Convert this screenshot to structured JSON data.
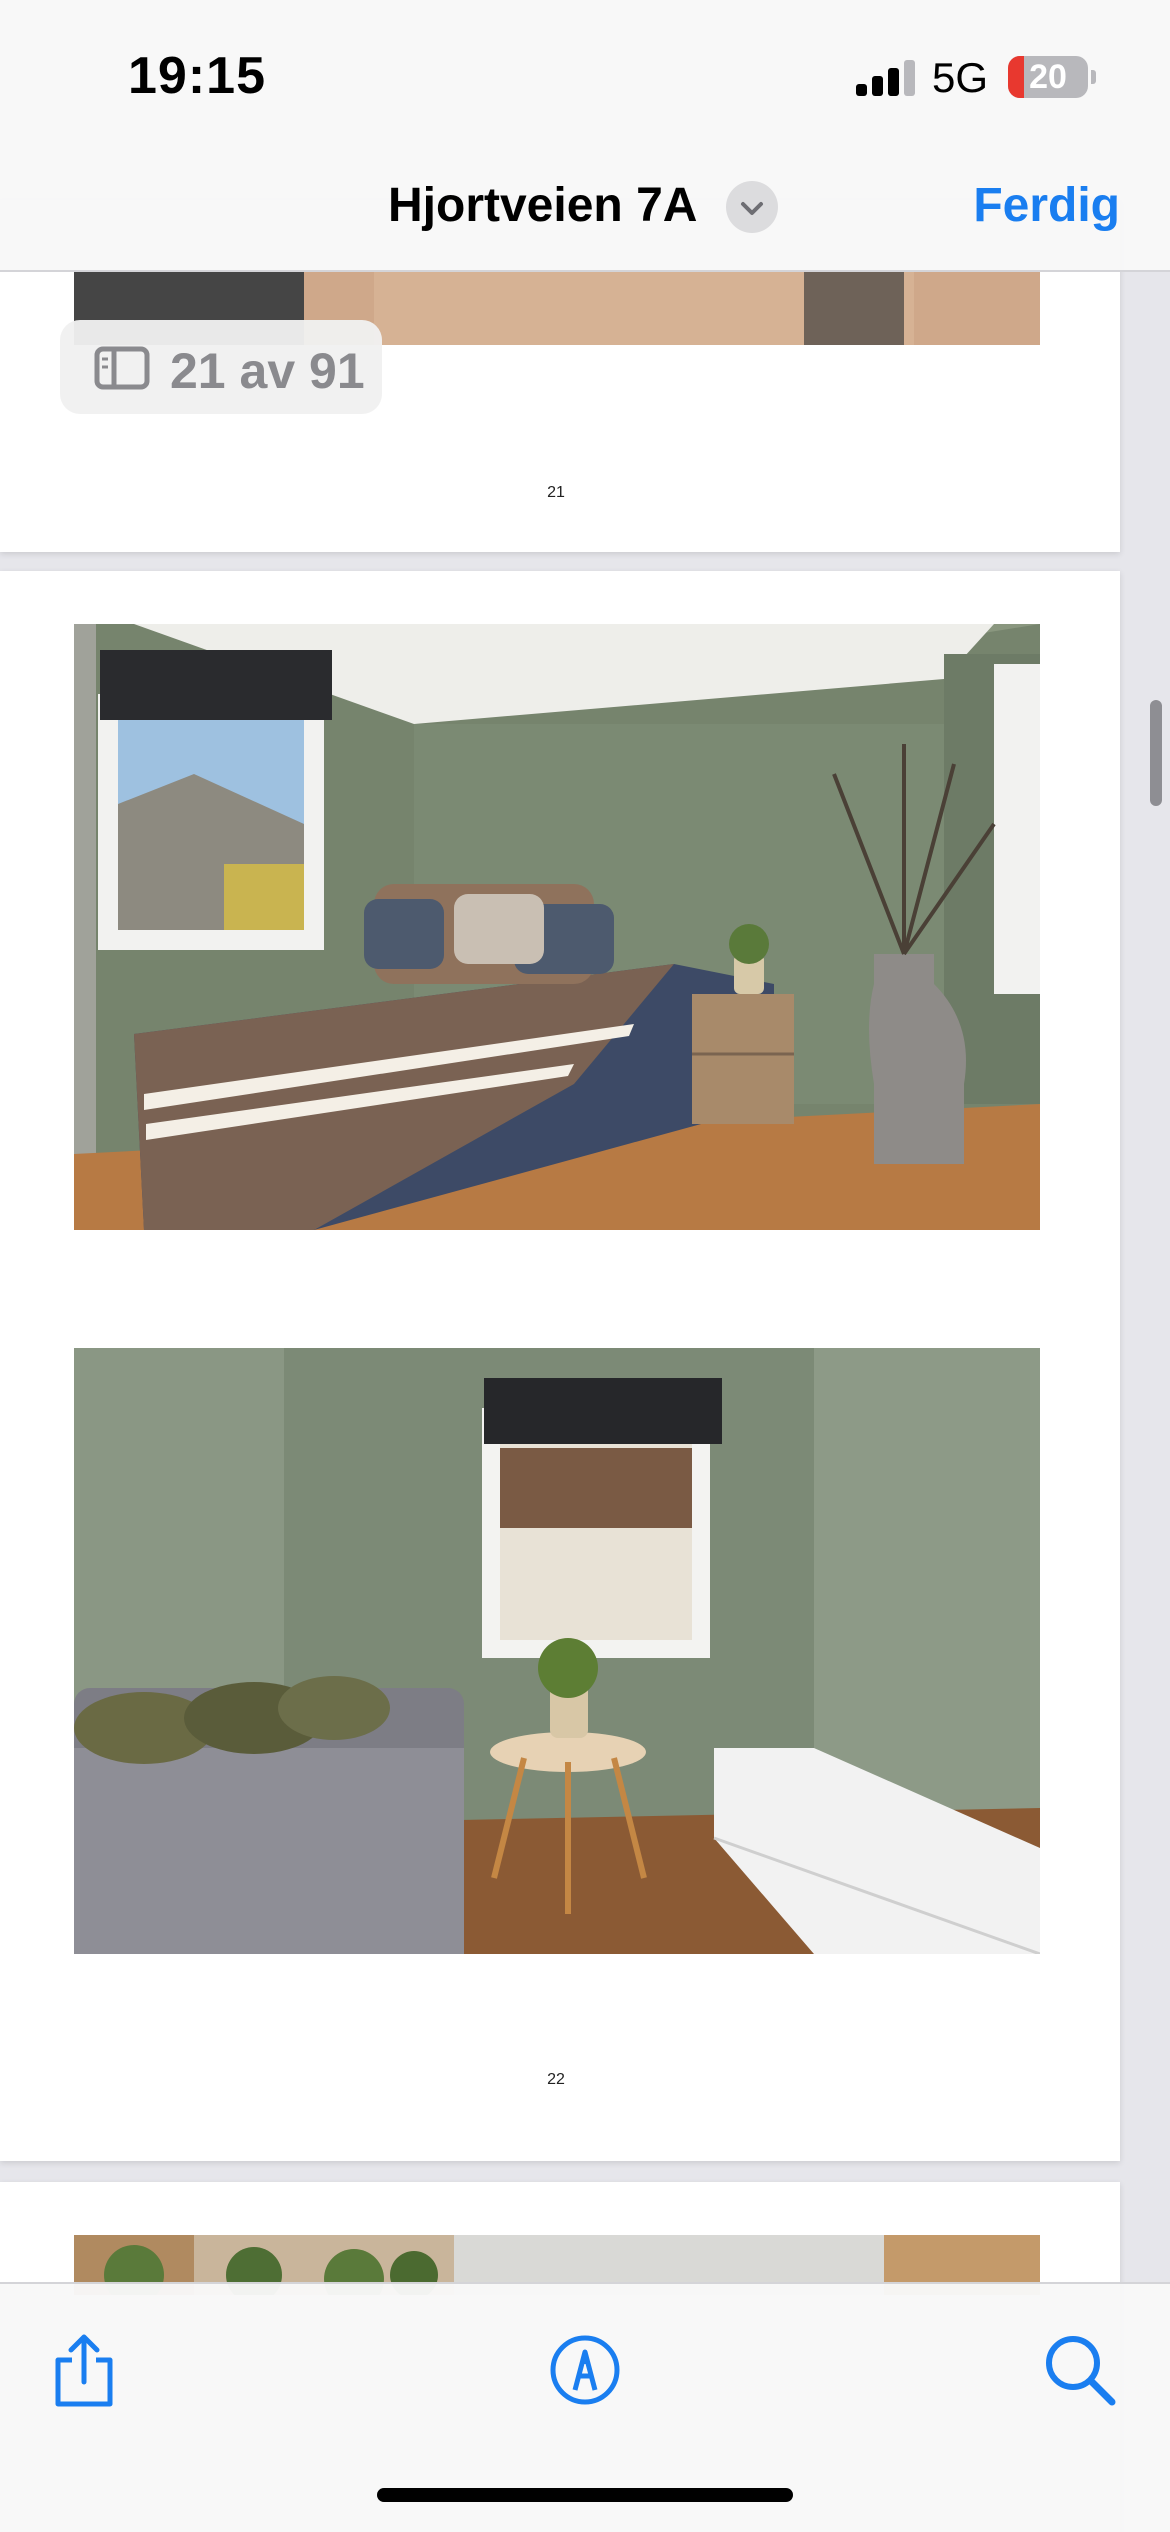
{
  "status_bar": {
    "time": "19:15",
    "network": "5G",
    "battery_level": "20"
  },
  "nav": {
    "title": "Hjortveien 7A",
    "done_label": "Ferdig"
  },
  "page_indicator": {
    "text": "21 av 91"
  },
  "pages": [
    {
      "number": "21"
    },
    {
      "number": "22"
    }
  ],
  "toolbar": {
    "share_icon": "share-icon",
    "markup_icon": "markup-pen-icon",
    "search_icon": "search-icon"
  },
  "colors": {
    "accent": "#1a7ef0",
    "battery_low": "#e8382f",
    "wall_green": "#7a8872"
  }
}
